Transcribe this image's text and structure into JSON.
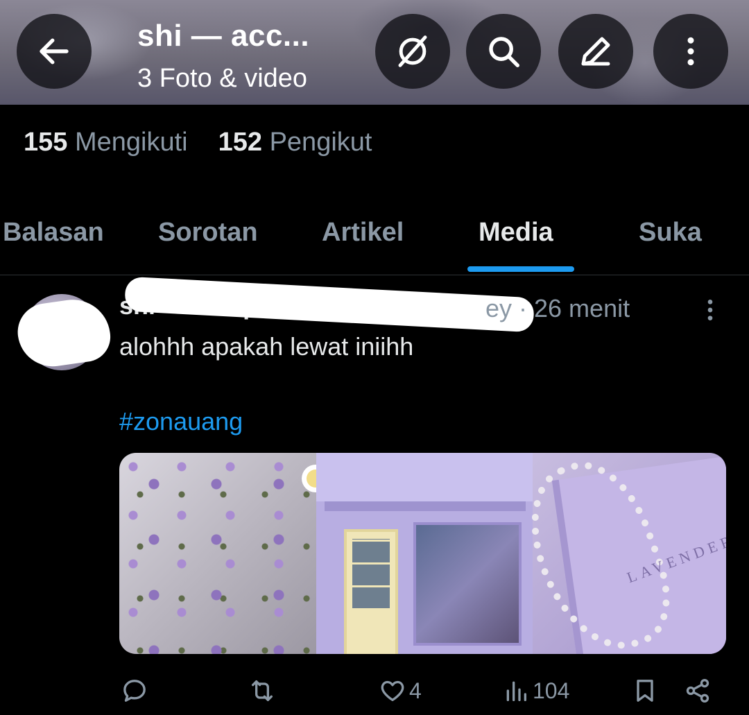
{
  "header": {
    "title": "shi — acc...",
    "subtitle": "3 Foto & video",
    "back_icon": "arrow-left-icon",
    "action_icons": [
      "grok-icon",
      "search-icon",
      "edit-icon",
      "more-vertical-icon"
    ]
  },
  "counts": {
    "following_num": "155",
    "following_label": "Mengikuti",
    "followers_num": "152",
    "followers_label": "Pengikut"
  },
  "tabs": [
    {
      "label": "Balasan",
      "active": false
    },
    {
      "label": "Sorotan",
      "active": false
    },
    {
      "label": "Artikel",
      "active": false
    },
    {
      "label": "Media",
      "active": true
    },
    {
      "label": "Suka",
      "active": false
    }
  ],
  "tweet": {
    "name": "shi — acc prom",
    "time": "ey · 26 menit",
    "text": "alohhh apakah lewat iniihh",
    "hashtag": "#zonauang",
    "media_text": "LAVENDER",
    "actions": {
      "reply_count": "",
      "retweet_count": "",
      "like_count": "4",
      "views_count": "104"
    }
  },
  "colors": {
    "accent": "#1d9bf0",
    "background": "#000000",
    "muted": "#8b98a5",
    "text": "#e7e9ea"
  }
}
